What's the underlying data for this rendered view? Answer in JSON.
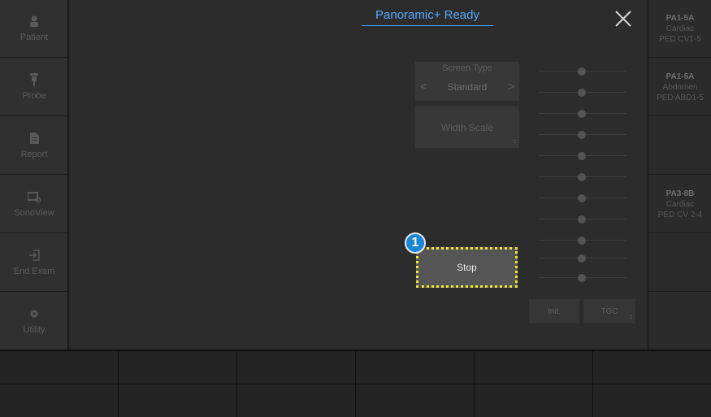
{
  "header": {
    "title": "Panoramic+ Ready"
  },
  "sidebar": {
    "items": [
      {
        "label": "Patient",
        "icon": "person-icon"
      },
      {
        "label": "Probe",
        "icon": "probe-icon"
      },
      {
        "label": "Report",
        "icon": "document-icon"
      },
      {
        "label": "SonoView",
        "icon": "sonoview-icon"
      },
      {
        "label": "End Exam",
        "icon": "exit-icon"
      },
      {
        "label": "Utility",
        "icon": "gear-icon"
      }
    ]
  },
  "presets": [
    {
      "probe": "PA1-5A",
      "app": "Cardiac",
      "preset": "PED CV1-5"
    },
    {
      "probe": "PA1-5A",
      "app": "Abdomen",
      "preset": "PED ABD1-5"
    },
    {
      "probe": "",
      "app": "",
      "preset": ""
    },
    {
      "probe": "PA3-8B",
      "app": "Cardiac",
      "preset": "PED CV 2-4"
    },
    {
      "probe": "",
      "app": "",
      "preset": ""
    },
    {
      "probe": "",
      "app": "",
      "preset": ""
    }
  ],
  "screen_type": {
    "label": "Screen Type",
    "value": "Standard",
    "prev": "<",
    "next": ">"
  },
  "width_scale": {
    "label": "Width Scale"
  },
  "stop_button": {
    "label": "Stop"
  },
  "callout": {
    "number": "1",
    "color": "#1a86d6"
  },
  "highlight_color": "#f0e531",
  "tgc": {
    "init_label": "Init.",
    "tgc_label": "TGC"
  },
  "close_icon": "close-icon"
}
